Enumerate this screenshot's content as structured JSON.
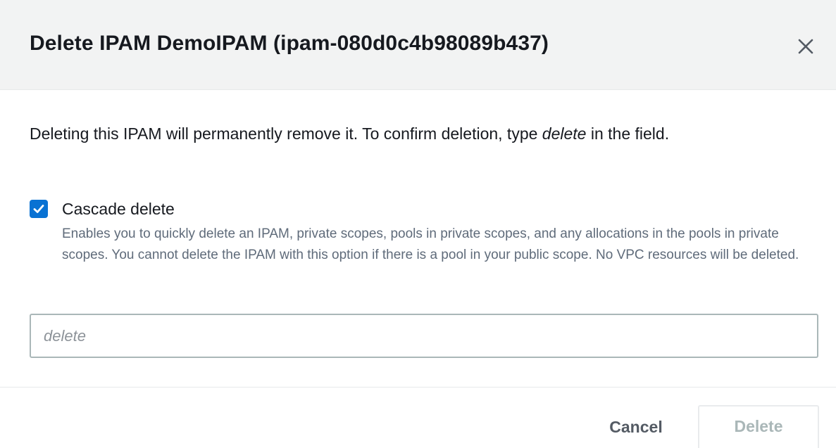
{
  "dialog": {
    "title": "Delete IPAM DemoIPAM (ipam-080d0c4b98089b437)",
    "close_icon": "close-icon"
  },
  "body": {
    "description_before": "Deleting this IPAM will permanently remove it. To confirm deletion, type ",
    "description_emphasis": "delete",
    "description_after": " in the field.",
    "cascade": {
      "label": "Cascade delete",
      "checked": true,
      "description": "Enables you to quickly delete an IPAM, private scopes, pools in private scopes, and any allocations in the pools in private scopes. You cannot delete the IPAM with this option if there is a pool in your public scope. No VPC resources will be deleted."
    },
    "confirm_input": {
      "value": "",
      "placeholder": "delete"
    }
  },
  "footer": {
    "cancel_label": "Cancel",
    "delete_label": "Delete",
    "delete_enabled": false
  },
  "colors": {
    "header_bg": "#f2f3f3",
    "checkbox_accent": "#0972d3",
    "secondary_text": "#5f6b7a",
    "disabled_text": "#aab7b8"
  }
}
